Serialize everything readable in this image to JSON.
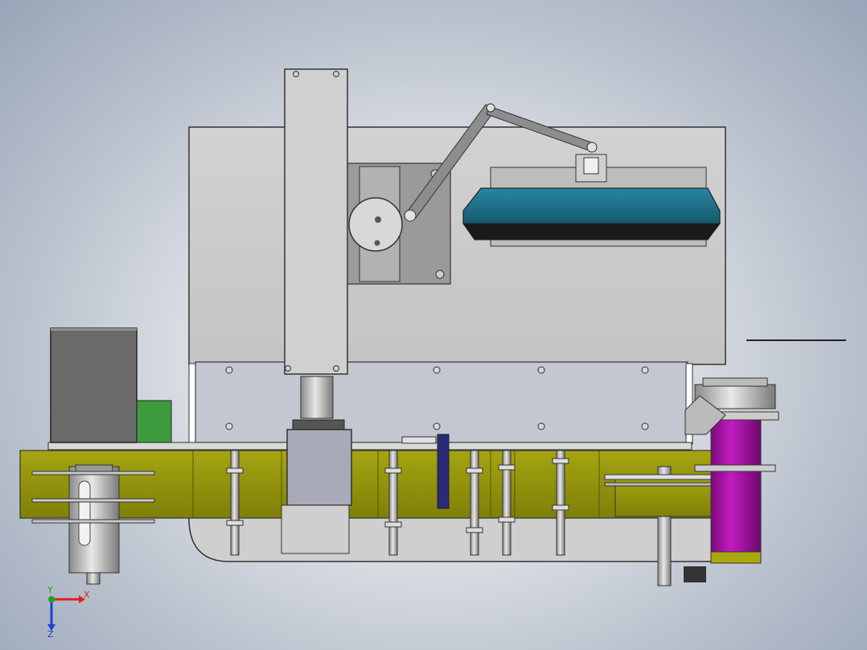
{
  "viewport": {
    "background_center": "#f3f4f7",
    "background_edge": "#98a5b8"
  },
  "colors": {
    "frame_gray": "#c8c8c8",
    "dark_gray": "#6d6d6d",
    "olive": "#8e8e0a",
    "olive_light": "#a9a90e",
    "magenta": "#a412a4",
    "teal": "#1e6f86",
    "green": "#3d9a3d",
    "navy": "#2a2a7a"
  },
  "triad": {
    "x_label": "X",
    "y_label": "Y",
    "z_label": "Z",
    "x_color": "#e02020",
    "y_color": "#20a020",
    "z_color": "#2040d0"
  }
}
